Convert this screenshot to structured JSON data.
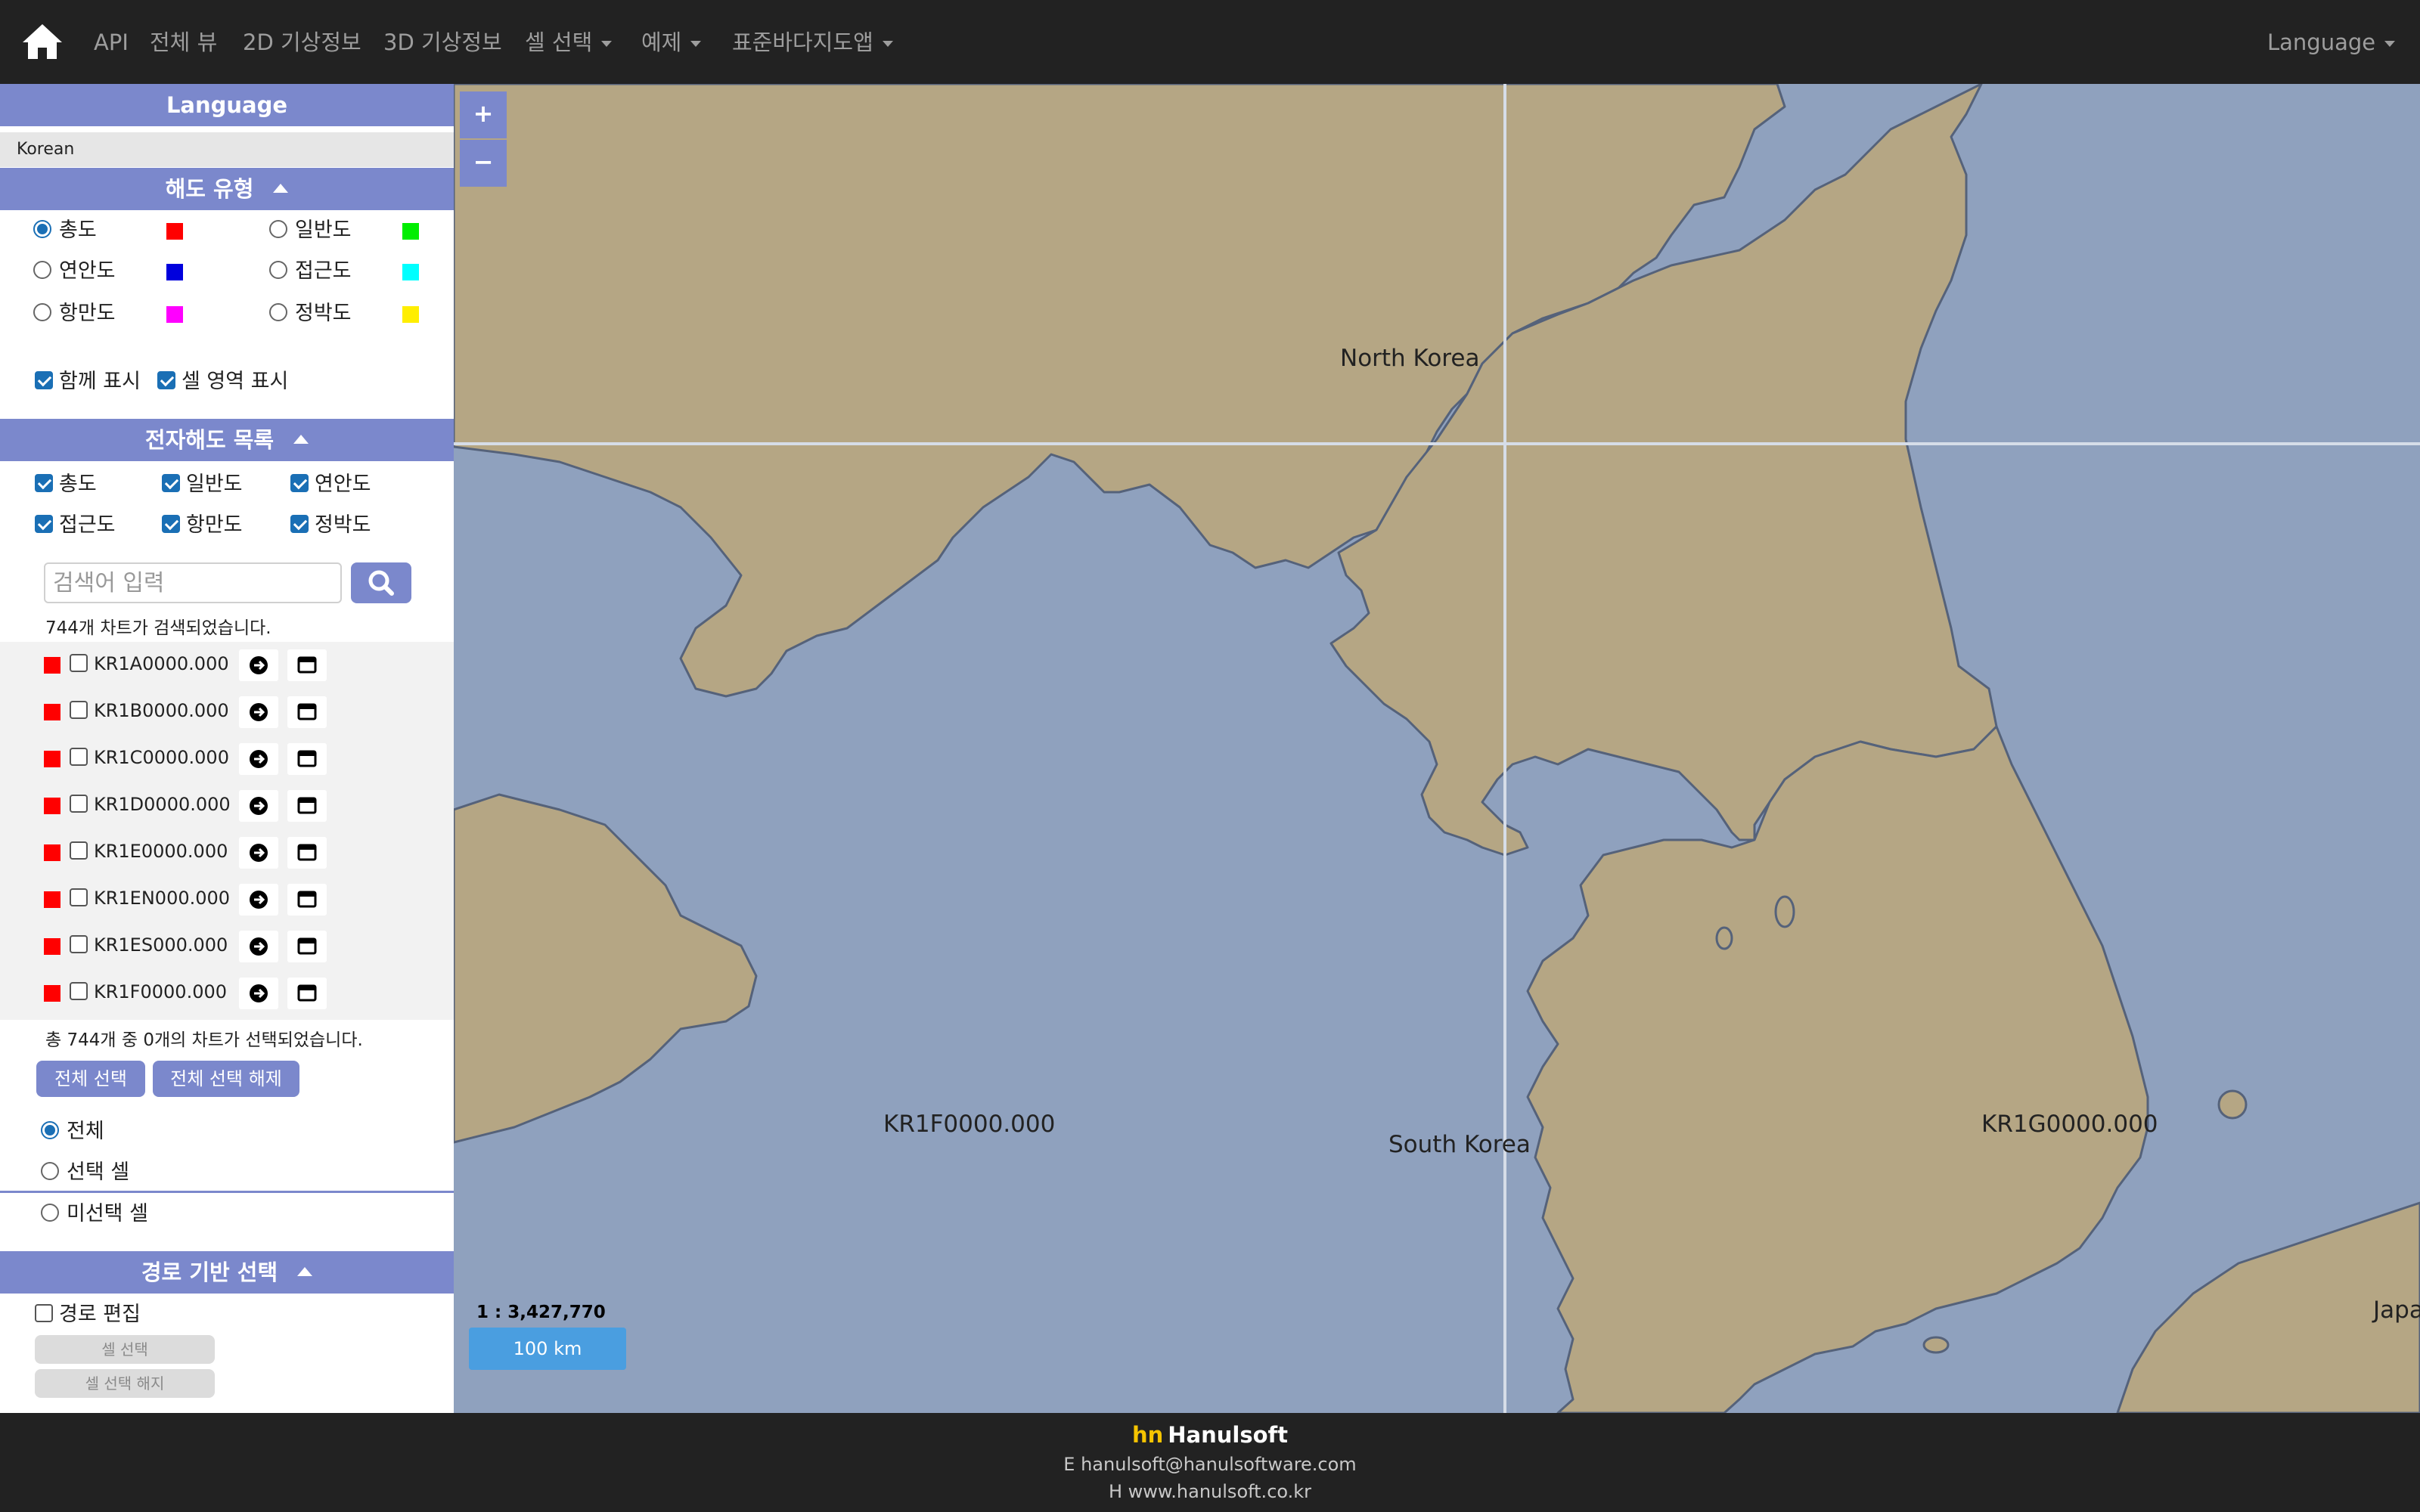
{
  "nav": {
    "items": [
      {
        "label": "API"
      },
      {
        "label": "전체 뷰"
      },
      {
        "label": "2D 기상정보"
      },
      {
        "label": "3D 기상정보"
      },
      {
        "label": "셀 선택"
      },
      {
        "label": "예제"
      },
      {
        "label": "표준바다지도앱"
      }
    ],
    "language": "Language"
  },
  "sidebar": {
    "language_title": "Language",
    "language_value": "Korean",
    "chart_type": {
      "title": "해도 유형",
      "options": [
        {
          "label": "총도",
          "color": "#ff0000",
          "checked": true
        },
        {
          "label": "일반도",
          "color": "#00ee00",
          "checked": false
        },
        {
          "label": "연안도",
          "color": "#0000dd",
          "checked": false
        },
        {
          "label": "접근도",
          "color": "#00ffff",
          "checked": false
        },
        {
          "label": "항만도",
          "color": "#ff00ff",
          "checked": false
        },
        {
          "label": "정박도",
          "color": "#ffee00",
          "checked": false
        }
      ],
      "show_together": "함께 표시",
      "show_cell_area": "셀 영역 표시"
    },
    "enc_list": {
      "title": "전자해도 목록",
      "filters": [
        "총도",
        "일반도",
        "연안도",
        "접근도",
        "항만도",
        "정박도"
      ],
      "search_placeholder": "검색어 입력",
      "result_text": "744개 차트가 검색되었습니다.",
      "charts": [
        "KR1A0000.000",
        "KR1B0000.000",
        "KR1C0000.000",
        "KR1D0000.000",
        "KR1E0000.000",
        "KR1EN000.000",
        "KR1ES000.000",
        "KR1F0000.000"
      ],
      "selected_text": "총 744개 중 0개의 차트가 선택되었습니다.",
      "select_all": "전체 선택",
      "deselect_all": "전체 선택 해제",
      "view_options": [
        "전체",
        "선택 셀",
        "미선택 셀"
      ]
    },
    "route": {
      "title": "경로 기반 선택",
      "edit_label": "경로 편집",
      "cell_select": "셀 선택",
      "cell_deselect": "셀 선택 해지"
    }
  },
  "map": {
    "labels": {
      "north_korea": "North Korea",
      "south_korea": "South Korea",
      "cell_left": "KR1F0000.000",
      "cell_right": "KR1G0000.000",
      "japan": "Japa"
    },
    "scale_ratio": "1 : 3,427,770",
    "scale_bar": "100 km",
    "colors": {
      "sea": "#8fa1be",
      "land": "#b5a684",
      "coast": "#55627a"
    }
  },
  "footer": {
    "brand_mark": "hn",
    "brand": "Hanulsoft",
    "email": "E hanulsoft@hanulsoftware.com",
    "homepage": "H www.hanulsoft.co.kr"
  }
}
